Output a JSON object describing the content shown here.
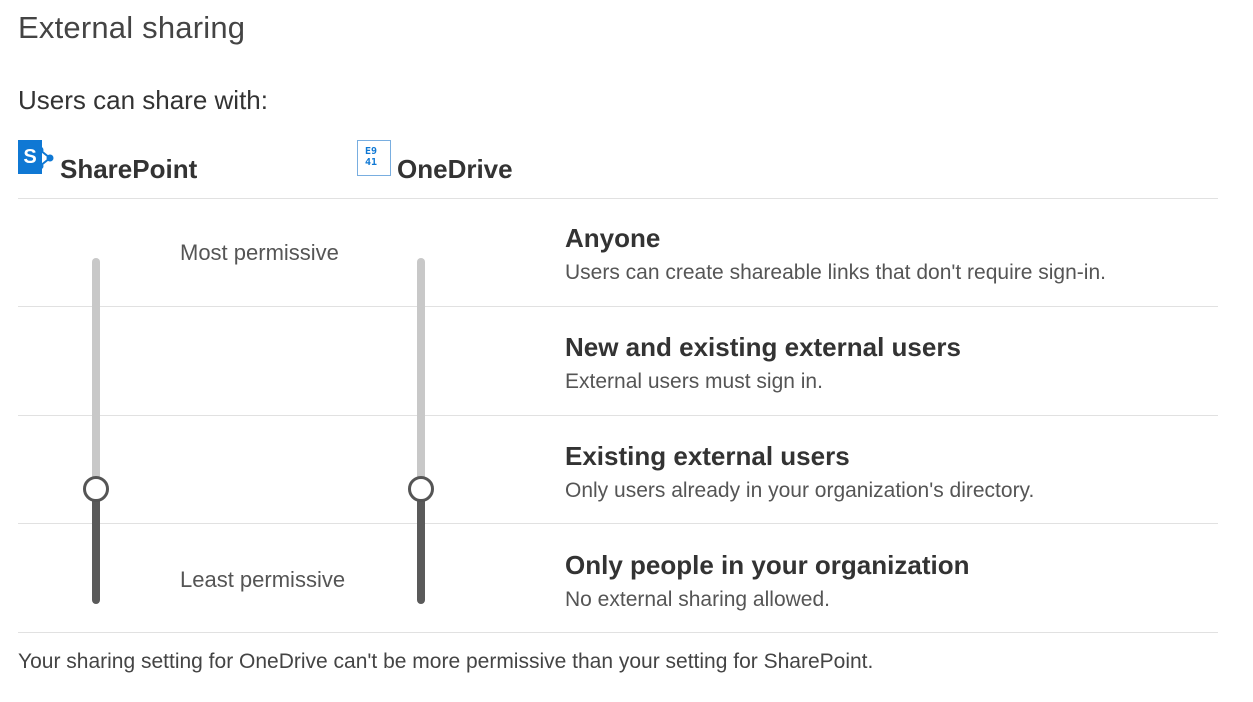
{
  "page": {
    "title": "External sharing",
    "subtitle": "Users can share with:",
    "footnote": "Your sharing setting for OneDrive can't be more permissive than your setting for SharePoint."
  },
  "services": {
    "sharepoint": {
      "label": "SharePoint",
      "icon": "sharepoint-icon",
      "icon_letter": "S",
      "color": "#0f78d4"
    },
    "onedrive": {
      "label": "OneDrive",
      "icon": "onedrive-icon",
      "color": "#0f78d4"
    }
  },
  "slider": {
    "top_label": "Most permissive",
    "bottom_label": "Least permissive",
    "sharepoint_level": "Existing external users",
    "onedrive_level": "Existing external users"
  },
  "options": [
    {
      "title": "Anyone",
      "desc": "Users can create shareable links that don't require sign-in."
    },
    {
      "title": "New and existing external users",
      "desc": "External users must sign in."
    },
    {
      "title": "Existing external users",
      "desc": "Only users already in your organization's directory."
    },
    {
      "title": "Only people in your organization",
      "desc": "No external sharing allowed."
    }
  ]
}
